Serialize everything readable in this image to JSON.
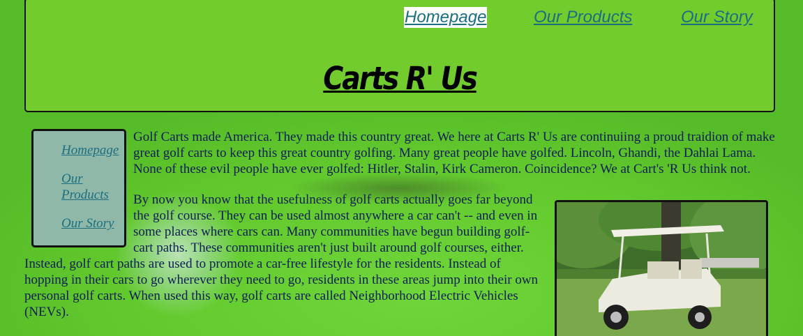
{
  "top_nav": {
    "home": "Homepage",
    "products": "Our Products",
    "story": "Our Story"
  },
  "site_title": "Carts R' Us",
  "side_nav": {
    "home": "Homepage",
    "products": "Our Products",
    "story": "Our Story"
  },
  "paragraphs": [
    "Golf Carts made America. They made this country great. We here at Carts R' Us are continuiing a proud traidion of make great golf carts to keep this great country golfing. Many great people have golfed. Lincoln, Ghandi, the Dahlai Lama. None of these evil people have ever golfed: Hitler, Stalin, Kirk Cameron. Coincidence? We at Cart's 'R Us think not.",
    "By now you know that the usefulness of golf carts actually goes far beyond the golf course. They can be used almost anywhere a car can't -- and even in some places where cars can. Many communities have begun building golf-cart paths. These communities aren't just built around golf courses, either. Instead, golf cart paths are used to promote a car-free lifestyle for the residents. Instead of hopping in their cars to go wherever they need to go, residents in these areas jump into their own personal golf carts. When used this way, golf carts are called Neighborhood Electric Vehicles (NEVs)."
  ],
  "image": {
    "subject": "white golf cart on grass in front of trees"
  }
}
